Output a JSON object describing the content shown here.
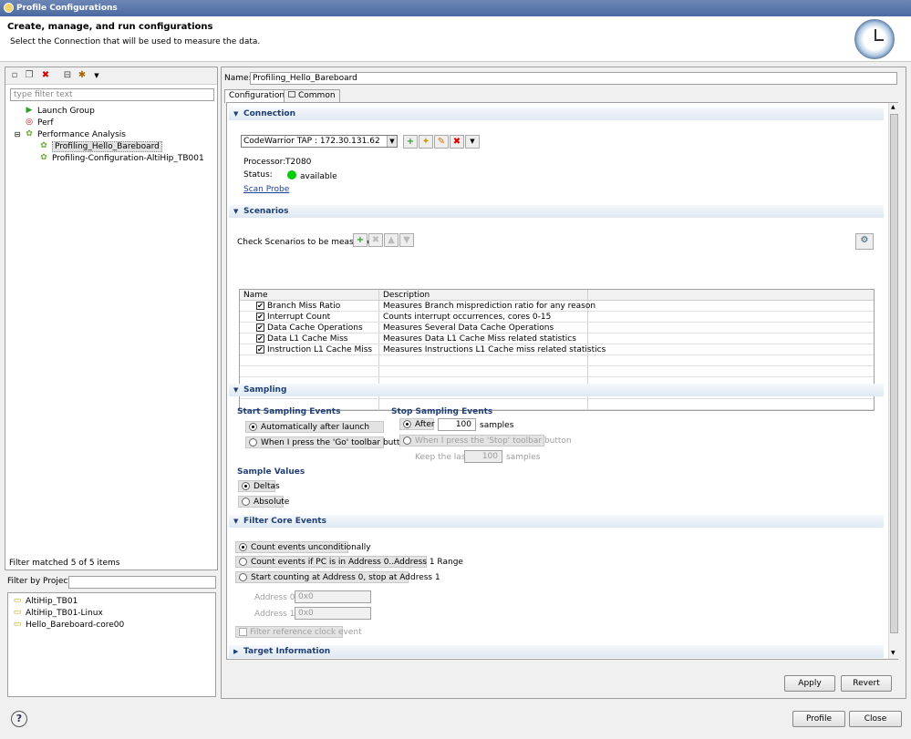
{
  "window": {
    "title": "Profile Configurations"
  },
  "header": {
    "title": "Create, manage, and run configurations",
    "subtitle": "Select the Connection that will be used to measure the data."
  },
  "left": {
    "filter_placeholder": "type filter text",
    "tree": [
      {
        "label": "Launch Group",
        "icon": "launch-group-icon",
        "indent": 1
      },
      {
        "label": "Perf",
        "icon": "perf-icon",
        "indent": 1
      },
      {
        "label": "Performance Analysis",
        "icon": "performance-analysis-icon",
        "indent": 0
      },
      {
        "label": "Profiling_Hello_Bareboard",
        "icon": "config-icon",
        "indent": 2,
        "selected": true
      },
      {
        "label": "Profiling-Configuration-AltiHip_TB001",
        "icon": "config-icon",
        "indent": 2
      }
    ],
    "status": "Filter matched 5 of 5 items",
    "project_filter_label": "Filter by Project:",
    "projects": [
      "AltiHip_TB01",
      "AltiHip_TB01-Linux",
      "Hello_Bareboard-core00"
    ]
  },
  "right": {
    "name_label": "Name:",
    "name_value": "Profiling_Hello_Bareboard",
    "tabs": [
      "Configuration",
      "Common"
    ],
    "connection": {
      "section": "Connection",
      "combo_value": "CodeWarrior TAP : 172.30.131.62",
      "processor_label": "Processor:",
      "processor_value": "T2080",
      "status_label": "Status:",
      "status_value": "available",
      "status_color": "#00cc00",
      "scan_probe": "Scan Probe"
    },
    "scenarios": {
      "section": "Scenarios",
      "instruction": "Check Scenarios to be measured.",
      "col_name": "Name",
      "col_desc": "Description",
      "rows": [
        {
          "name": "Branch Miss Ratio",
          "desc": "Measures Branch misprediction ratio for any reason"
        },
        {
          "name": "Interrupt Count",
          "desc": "Counts interrupt occurrences, cores 0-15"
        },
        {
          "name": "Data Cache Operations",
          "desc": "Measures Several Data Cache Operations"
        },
        {
          "name": "Data L1 Cache Miss",
          "desc": "Measures Data L1 Cache Miss related statistics"
        },
        {
          "name": "Instruction L1 Cache Miss",
          "desc": "Measures Instructions L1 Cache miss related statistics"
        }
      ]
    },
    "sampling": {
      "section": "Sampling",
      "start_title": "Start Sampling Events",
      "start_auto": "Automatically after launch",
      "start_go": "When I press the 'Go' toolbar button",
      "stop_title": "Stop Sampling Events",
      "stop_after": "After",
      "stop_after_value": "100",
      "samples": "samples",
      "stop_button": "When I press the 'Stop' toolbar button",
      "keep_last": "Keep the last",
      "keep_value": "100",
      "values_title": "Sample Values",
      "deltas": "Deltas",
      "absolute": "Absolute"
    },
    "filter_core": {
      "section": "Filter Core Events",
      "opt1": "Count events unconditionally",
      "opt2": "Count events if PC is in Address 0..Address 1 Range",
      "opt3": "Start counting at Address 0, stop at Address 1",
      "addr0_label": "Address 0:",
      "addr0_value": "0x0",
      "addr1_label": "Address 1:",
      "addr1_value": "0x0",
      "ref_clock": "Filter reference clock event"
    },
    "target_info": {
      "section": "Target Information"
    },
    "apply": "Apply",
    "revert": "Revert"
  },
  "footer": {
    "profile": "Profile",
    "close": "Close",
    "help": "?"
  }
}
